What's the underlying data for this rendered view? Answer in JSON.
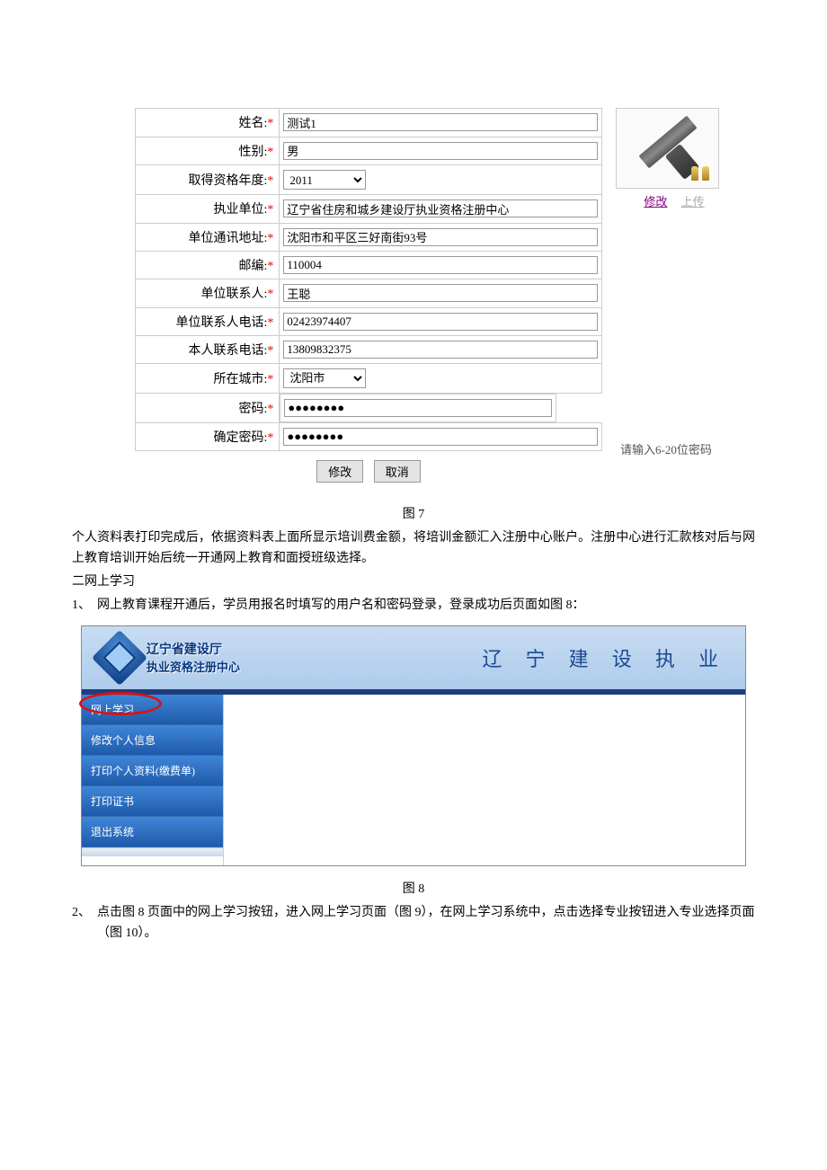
{
  "form": {
    "rows": {
      "name": {
        "label": "姓名:",
        "value": "测试1"
      },
      "gender": {
        "label": "性别:",
        "value": "男"
      },
      "qualYear": {
        "label": "取得资格年度:",
        "value": "2011"
      },
      "workUnit": {
        "label": "执业单位:",
        "value": "辽宁省住房和城乡建设厅执业资格注册中心"
      },
      "unitAddress": {
        "label": "单位通讯地址:",
        "value": "沈阳市和平区三好南街93号"
      },
      "postcode": {
        "label": "邮编:",
        "value": "110004"
      },
      "unitContact": {
        "label": "单位联系人:",
        "value": "王聪"
      },
      "unitContactPhone": {
        "label": "单位联系人电话:",
        "value": "02423974407"
      },
      "selfPhone": {
        "label": "本人联系电话:",
        "value": "13809832375"
      },
      "city": {
        "label": "所在城市:",
        "value": "沈阳市"
      },
      "password": {
        "label": "密码:",
        "value": "●●●●●●●●",
        "hint": "请输入6-20位密码"
      },
      "passwordConfirm": {
        "label": "确定密码:",
        "value": "●●●●●●●●"
      }
    },
    "photoLinks": {
      "edit": "修改",
      "upload": "上传"
    },
    "buttons": {
      "modify": "修改",
      "cancel": "取消"
    }
  },
  "captions": {
    "fig7": "图 7",
    "fig8": "图 8"
  },
  "paragraphs": {
    "p1": "个人资料表打印完成后，依据资料表上面所显示培训费金额，将培训金额汇入注册中心账户。注册中心进行汇款核对后与网上教育培训开始后统一开通网上教育和面授班级选择。",
    "sec2": "二网上学习",
    "li1": "网上教育课程开通后，学员用报名时填写的用户名和密码登录，登录成功后页面如图 8：",
    "li2": "点击图 8 页面中的网上学习按钮，进入网上学习页面（图 9），在网上学习系统中，点击选择专业按钮进入专业选择页面（图 10）。"
  },
  "fig8": {
    "brandLine1": "辽宁省建设厅",
    "brandLine2": "执业资格注册中心",
    "rightTitle": "辽 宁 建 设 执 业",
    "sidebar": [
      "网上学习",
      "修改个人信息",
      "打印个人资料(缴费单)",
      "打印证书",
      "退出系统"
    ]
  }
}
